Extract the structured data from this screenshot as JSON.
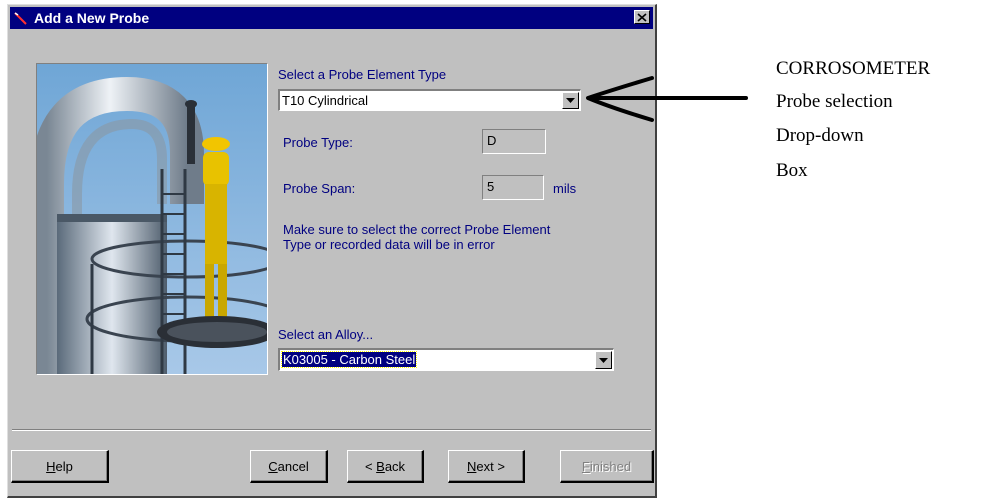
{
  "dialog": {
    "title": "Add a New Probe",
    "close_glyph": "✕"
  },
  "probe_element": {
    "label": "Select a Probe Element Type",
    "selected": "T10 Cylindrical"
  },
  "probe_type": {
    "label": "Probe Type:",
    "value": "D"
  },
  "probe_span": {
    "label": "Probe Span:",
    "value": "5",
    "unit": "mils"
  },
  "warning": {
    "line1": "Make sure to select the correct Probe Element",
    "line2": "Type or recorded data will be in error"
  },
  "alloy": {
    "label": "Select an Alloy...",
    "selected": "K03005 - Carbon Steel"
  },
  "buttons": {
    "help": {
      "pre": "",
      "key": "H",
      "post": "elp"
    },
    "cancel": {
      "pre": "",
      "key": "C",
      "post": "ancel"
    },
    "back": {
      "pre": "< ",
      "key": "B",
      "post": "ack"
    },
    "next": {
      "pre": "",
      "key": "N",
      "post": "ext >"
    },
    "finished": {
      "pre": "",
      "key": "F",
      "post": "inished"
    }
  },
  "annotation": {
    "line1": "CORROSOMETER",
    "line2": "Probe selection",
    "line3": "Drop-down",
    "line4": "Box"
  },
  "colors": {
    "titlebar": "#000080",
    "face": "#c0c0c0",
    "label_text": "#000080",
    "selection": "#000080"
  },
  "icons": {
    "title": "probe-icon",
    "close": "close-icon",
    "dropdown": "dropdown-arrow-icon",
    "pointer": "arrow-icon"
  }
}
